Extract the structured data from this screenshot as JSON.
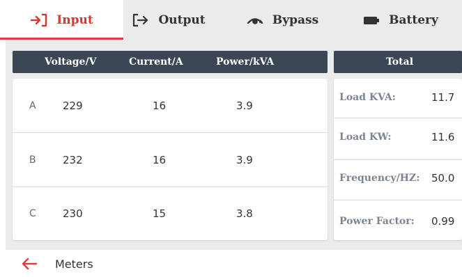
{
  "tabs": [
    {
      "label": "Input",
      "icon": "login-icon",
      "active": true
    },
    {
      "label": "Output",
      "icon": "logout-icon",
      "active": false
    },
    {
      "label": "Bypass",
      "icon": "bypass-icon",
      "active": false
    },
    {
      "label": "Battery",
      "icon": "battery-icon",
      "active": false
    }
  ],
  "phase_table": {
    "headers": [
      "Voltage/V",
      "Current/A",
      "Power/kVA"
    ],
    "rows": [
      {
        "phase": "A",
        "voltage": "229",
        "current": "16",
        "power": "3.9"
      },
      {
        "phase": "B",
        "voltage": "232",
        "current": "16",
        "power": "3.9"
      },
      {
        "phase": "C",
        "voltage": "230",
        "current": "15",
        "power": "3.8"
      }
    ]
  },
  "total": {
    "header": "Total",
    "items": [
      {
        "label": "Load KVA:",
        "value": "11.7"
      },
      {
        "label": "Load KW:",
        "value": "11.6"
      },
      {
        "label": "Frequency/HZ:",
        "value": "50.0"
      },
      {
        "label": "Power Factor:",
        "value": "0.99"
      }
    ]
  },
  "footer": {
    "label": "Meters",
    "icon": "back-arrow-icon"
  },
  "colors": {
    "accent": "#e23b3b",
    "header_bg": "#3c4755",
    "panel_bg": "#ebebeb",
    "label_gray": "#7a8591"
  }
}
